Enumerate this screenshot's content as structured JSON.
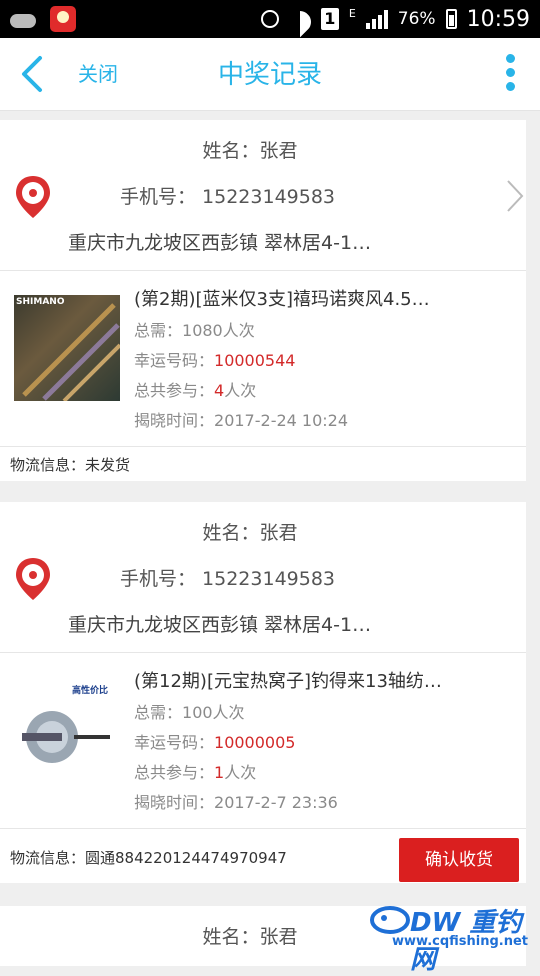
{
  "status_bar": {
    "battery": "76%",
    "time": "10:59",
    "network": "E",
    "sim": "1"
  },
  "header": {
    "back_icon": "chevron-left-icon",
    "close_label": "关闭",
    "title": "中奖记录",
    "more_icon": "more-vertical-icon"
  },
  "colors": {
    "accent": "#29b4e8",
    "highlight": "#d32a2a",
    "button": "#da1f1f"
  },
  "records": [
    {
      "name": "姓名：张君",
      "phone": "手机号： 15223149583",
      "address": "重庆市九龙坡区西彭镇 翠林居4-1…",
      "product_title": "(第2期)[蓝米仅3支]禧玛诺爽风4.5…",
      "need_label": "总需：",
      "need_value": "1080人次",
      "lucky_label": "幸运号码：",
      "lucky_value": "10000544",
      "total_label": "总共参与：",
      "total_count": "4",
      "total_unit": "人次",
      "reveal_label": "揭晓时间：",
      "reveal_time": "2017-2-24 10:24",
      "logistics": "物流信息：未发货",
      "thumb_text": "SHIMANO"
    },
    {
      "name": "姓名：张君",
      "phone": "手机号： 15223149583",
      "address": "重庆市九龙坡区西彭镇 翠林居4-1…",
      "product_title": "(第12期)[元宝热窝子]钓得来13轴纺…",
      "need_label": "总需：",
      "need_value": "100人次",
      "lucky_label": "幸运号码：",
      "lucky_value": "10000005",
      "total_label": "总共参与：",
      "total_count": "1",
      "total_unit": "人次",
      "reveal_label": "揭晓时间：",
      "reveal_time": "2017-2-7 23:36",
      "logistics": "物流信息：圆通884220124474970947",
      "confirm_label": "确认收货",
      "thumb_text": "高性价比"
    },
    {
      "name": "姓名：张君"
    }
  ],
  "watermark": {
    "brand": "DW 重钓网",
    "url": "www.cqfishing.net"
  }
}
